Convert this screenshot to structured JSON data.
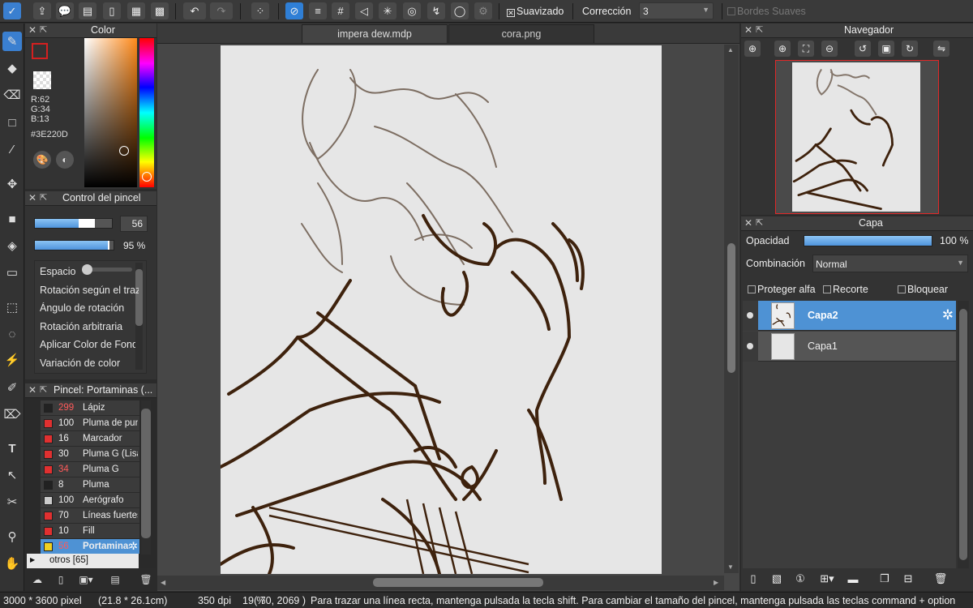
{
  "toolbar": {
    "smoothing_label": "Suavizado",
    "correction_label": "Corrección",
    "correction_value": "3",
    "soft_edges_label": "Bordes Suaves"
  },
  "tabs": [
    {
      "label": "impera dew.mdp",
      "active": true
    },
    {
      "label": "cora.png",
      "active": false
    }
  ],
  "color_panel": {
    "title": "Color",
    "r": "R:62",
    "g": "G:34",
    "b": "B:13",
    "hex": "#3E220D",
    "current_color": "#3E220D"
  },
  "brush_control": {
    "title": "Control del pincel",
    "size_value": "56",
    "opacity_value": "95 %",
    "size_fraction": 0.78,
    "opacity_fraction": 0.95,
    "settings": [
      "Espacio",
      "Rotación según el trazo",
      "Ángulo de rotación",
      "Rotación arbitraria",
      "Aplicar Color de Fondo",
      "Variación de color"
    ]
  },
  "brush_list": {
    "title": "Pincel: Portaminas (...",
    "items": [
      {
        "size": "299",
        "name": "Lápiz",
        "swatch": "#222222",
        "red_size": true,
        "selected": false
      },
      {
        "size": "100",
        "name": "Pluma de punta",
        "swatch": "#e03030",
        "red_size": false,
        "selected": false
      },
      {
        "size": "16",
        "name": "Marcador",
        "swatch": "#e03030",
        "red_size": false,
        "selected": false
      },
      {
        "size": "30",
        "name": "Pluma G (Lisa)",
        "swatch": "#e03030",
        "red_size": false,
        "selected": false
      },
      {
        "size": "34",
        "name": "Pluma G",
        "swatch": "#e03030",
        "red_size": true,
        "selected": false
      },
      {
        "size": "8",
        "name": "Pluma",
        "swatch": "#222222",
        "red_size": false,
        "selected": false
      },
      {
        "size": "100",
        "name": "Aerógrafo",
        "swatch": "#cccccc",
        "red_size": false,
        "selected": false
      },
      {
        "size": "70",
        "name": "Líneas fuertes",
        "swatch": "#e03030",
        "red_size": false,
        "selected": false
      },
      {
        "size": "10",
        "name": "Fill",
        "swatch": "#e03030",
        "red_size": false,
        "selected": false
      },
      {
        "size": "56",
        "name": "Portaminas",
        "swatch": "#f0d020",
        "red_size": true,
        "selected": true
      }
    ],
    "group": "otros [65]"
  },
  "navigator": {
    "title": "Navegador"
  },
  "layers_panel": {
    "title": "Capa",
    "opacity_label": "Opacidad",
    "opacity_value": "100 %",
    "opacity_fraction": 1.0,
    "blend_label": "Combinación",
    "blend_value": "Normal",
    "protect_alpha": "Proteger alfa",
    "clipping": "Recorte",
    "lock": "Bloquear",
    "layers": [
      {
        "name": "Capa2",
        "selected": true
      },
      {
        "name": "Capa1",
        "selected": false
      }
    ]
  },
  "status": {
    "size": "3000 * 3600 pixel",
    "cm": "(21.8 * 26.1cm)",
    "dpi": "350 dpi",
    "zoom": "19 %",
    "coords": "( 70, 2069 )",
    "hint": "Para trazar una línea recta, mantenga pulsada la tecla shift. Para cambiar el tamaño del pincel, mantenga pulsada las teclas command + option"
  }
}
